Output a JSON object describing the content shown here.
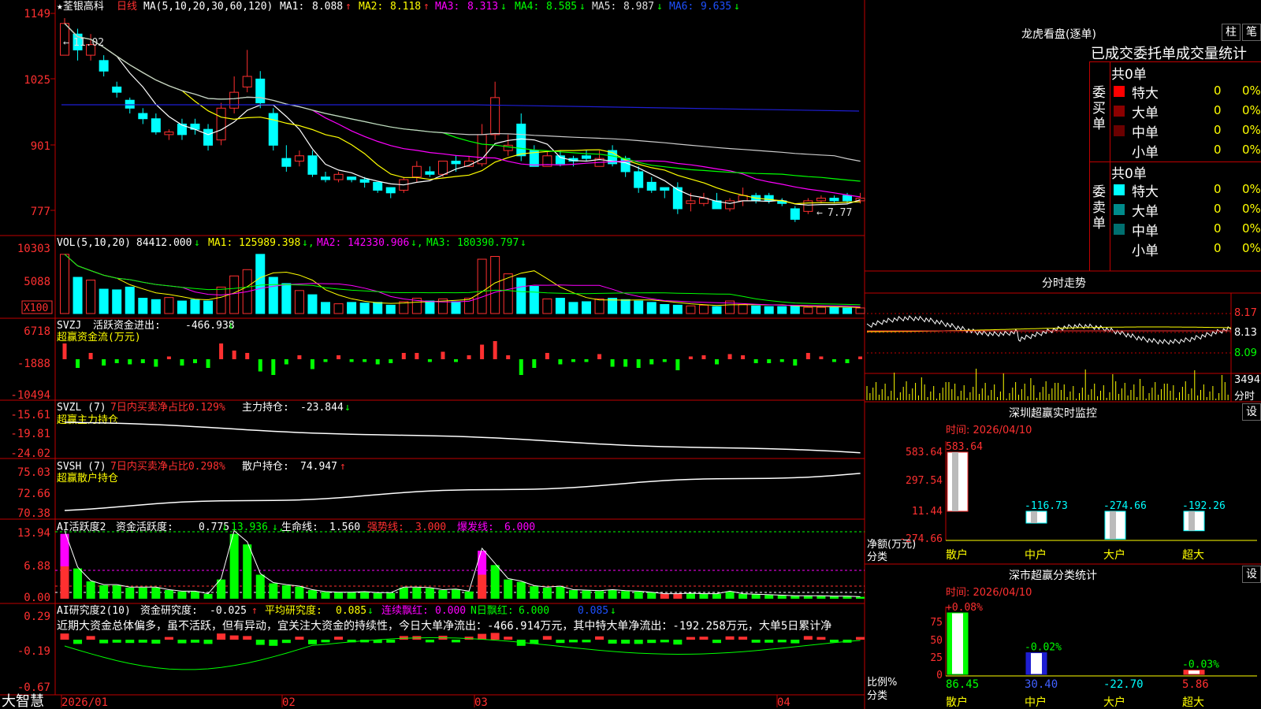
{
  "colors": {
    "up": "#ff3030",
    "down": "#00ffff",
    "bg": "#000000",
    "grid": "#b00000",
    "ma1": "#ffffff",
    "ma2": "#ffff00",
    "ma3": "#ff00ff",
    "ma4": "#00ff00",
    "ma5": "#cccccc",
    "ma6": "#1e1ed2"
  },
  "header": {
    "title": "★荃银高科",
    "period": "日线",
    "ma_params": "MA(5,10,20,30,60,120)",
    "ma": [
      {
        "label": "MA1:",
        "value": "8.088",
        "arrow": "↑"
      },
      {
        "label": "MA2:",
        "value": "8.118",
        "arrow": "↑"
      },
      {
        "label": "MA3:",
        "value": "8.313",
        "arrow": "↓"
      },
      {
        "label": "MA4:",
        "value": "8.585",
        "arrow": "↓"
      },
      {
        "label": "MA5:",
        "value": "8.987",
        "arrow": "↓"
      },
      {
        "label": "MA6:",
        "value": "9.635",
        "arrow": "↓"
      }
    ]
  },
  "price_axis": [
    "1149",
    "1025",
    "901",
    "777"
  ],
  "price_annotations": {
    "high": "11.02",
    "low": "7.77"
  },
  "candles": [
    [
      10.7,
      11.3,
      10.7,
      11.4
    ],
    [
      11.1,
      10.8,
      10.6,
      11.2
    ],
    [
      10.7,
      10.9,
      10.6,
      11.1
    ],
    [
      10.6,
      10.4,
      10.3,
      10.7
    ],
    [
      10.1,
      10.0,
      9.9,
      10.2
    ],
    [
      9.85,
      9.7,
      9.6,
      9.9
    ],
    [
      9.6,
      9.5,
      9.4,
      9.7
    ],
    [
      9.5,
      9.25,
      9.2,
      9.6
    ],
    [
      9.2,
      9.25,
      9.1,
      9.3
    ],
    [
      9.4,
      9.2,
      9.1,
      9.5
    ],
    [
      9.4,
      9.3,
      9.2,
      9.5
    ],
    [
      9.3,
      9.0,
      8.9,
      9.4
    ],
    [
      9.1,
      9.7,
      9.0,
      9.8
    ],
    [
      9.7,
      10.0,
      9.6,
      10.3
    ],
    [
      10.1,
      10.3,
      10.0,
      10.8
    ],
    [
      10.25,
      9.8,
      9.7,
      10.4
    ],
    [
      9.6,
      9.0,
      8.9,
      9.7
    ],
    [
      8.75,
      8.6,
      8.5,
      9.0
    ],
    [
      8.7,
      8.8,
      8.6,
      8.9
    ],
    [
      8.8,
      8.45,
      8.4,
      8.9
    ],
    [
      8.4,
      8.35,
      8.3,
      8.5
    ],
    [
      8.35,
      8.45,
      8.3,
      8.5
    ],
    [
      8.4,
      8.35,
      8.3,
      8.4
    ],
    [
      8.35,
      8.3,
      8.2,
      8.4
    ],
    [
      8.3,
      8.15,
      8.1,
      8.3
    ],
    [
      8.2,
      8.1,
      8.0,
      8.2
    ],
    [
      8.15,
      8.35,
      8.1,
      8.4
    ],
    [
      8.4,
      8.6,
      8.3,
      8.7
    ],
    [
      8.5,
      8.45,
      8.4,
      8.6
    ],
    [
      8.45,
      8.7,
      8.4,
      8.7
    ],
    [
      8.7,
      8.65,
      8.5,
      8.8
    ],
    [
      8.6,
      8.7,
      8.6,
      8.8
    ],
    [
      8.65,
      9.2,
      8.6,
      9.4
    ],
    [
      9.2,
      9.9,
      9.1,
      10.2
    ],
    [
      8.9,
      9.0,
      8.8,
      9.2
    ],
    [
      9.4,
      8.8,
      8.7,
      9.6
    ],
    [
      8.9,
      8.6,
      8.6,
      9.0
    ],
    [
      8.6,
      8.8,
      8.6,
      8.9
    ],
    [
      8.8,
      8.65,
      8.6,
      8.9
    ],
    [
      8.75,
      8.7,
      8.6,
      8.8
    ],
    [
      8.8,
      8.75,
      8.7,
      8.9
    ],
    [
      8.6,
      8.75,
      8.6,
      8.9
    ],
    [
      8.9,
      8.65,
      8.6,
      9.0
    ],
    [
      8.75,
      8.5,
      8.4,
      8.8
    ],
    [
      8.5,
      8.2,
      8.1,
      8.6
    ],
    [
      8.3,
      8.15,
      8.1,
      8.4
    ],
    [
      8.2,
      8.15,
      8.0,
      8.2
    ],
    [
      8.2,
      7.8,
      7.7,
      8.3
    ],
    [
      7.9,
      7.95,
      7.75,
      8.1
    ],
    [
      7.9,
      8.0,
      7.85,
      8.1
    ],
    [
      7.95,
      7.8,
      7.8,
      8.1
    ],
    [
      7.8,
      7.95,
      7.75,
      8.0
    ],
    [
      7.95,
      8.05,
      7.85,
      8.2
    ],
    [
      8.05,
      7.95,
      7.9,
      8.1
    ],
    [
      8.05,
      7.95,
      7.9,
      8.1
    ],
    [
      7.95,
      7.9,
      7.85,
      8.0
    ],
    [
      7.8,
      7.6,
      7.55,
      7.85
    ],
    [
      7.75,
      7.95,
      7.7,
      8.0
    ],
    [
      7.95,
      8.0,
      7.9,
      8.05
    ],
    [
      8.0,
      7.95,
      7.9,
      8.05
    ],
    [
      8.05,
      7.95,
      7.9,
      8.1
    ],
    [
      7.95,
      8.0,
      7.9,
      8.1
    ]
  ],
  "vol_header": {
    "name": "VOL(5,10,20)",
    "value": "84412.000",
    "arrow": "↓",
    "ma1": "125989.398",
    "ma2": "142330.906",
    "ma3": "180390.797",
    "ma1_label": "MA1:",
    "ma2_label": "MA2:",
    "ma3_label": "MA3:"
  },
  "vol_axis": [
    "10303",
    "5088",
    "X100"
  ],
  "volumes": [
    8.5,
    5.2,
    4.8,
    3.5,
    3.4,
    3.8,
    2.2,
    2.0,
    2.3,
    1.8,
    2.0,
    1.8,
    3.8,
    5.4,
    6.3,
    8.5,
    5.2,
    4.3,
    3.3,
    2.7,
    1.6,
    1.4,
    1.6,
    1.5,
    1.6,
    1.2,
    1.7,
    2.2,
    1.8,
    2.1,
    1.7,
    2.2,
    7.8,
    8.2,
    5.7,
    5.1,
    3.9,
    2.1,
    2.2,
    1.6,
    1.7,
    2.1,
    2.2,
    2.0,
    1.8,
    1.6,
    1.3,
    1.2,
    1.1,
    1.2,
    1.0,
    1.8,
    1.3,
    1.1,
    1.0,
    1.0,
    1.1,
    0.9,
    0.9,
    0.9,
    0.8,
    0.8
  ],
  "svzj": {
    "name": "SVZJ",
    "desc": "活跃资金进出:",
    "value": "-466.938",
    "arrow": "↓",
    "sub": "超赢资金流(万元)",
    "axis": [
      "6718",
      "-1888",
      "-10494"
    ]
  },
  "svzl": {
    "name": "SVZL (7)",
    "desc": "7日内买卖净占比0.129%",
    "hold_label": "主力持仓:",
    "hold_value": "-23.844",
    "arrow": "↓",
    "sub": "超赢主力持仓",
    "axis": [
      "-15.61",
      "-19.81",
      "-24.02"
    ]
  },
  "svsh": {
    "name": "SVSH (7)",
    "desc": "7日内买卖净占比0.298%",
    "hold_label": "散户持仓:",
    "hold_value": "74.947",
    "arrow": "↑",
    "sub": "超赢散户持仓",
    "axis": [
      "75.03",
      "72.66",
      "70.38"
    ]
  },
  "ai1": {
    "name": "AI活跃度2",
    "l1": "资金活跃度:",
    "v1": "0.775",
    "a1": "↓",
    "v2": "13.936",
    "l3": "生命线:",
    "v3": "1.560",
    "l4": "强势线:",
    "v4": "3.000",
    "l5": "爆发线:",
    "v5": "6.000",
    "axis": [
      "13.94",
      "6.88",
      "0.00"
    ]
  },
  "ai2": {
    "name": "AI研究度2(10)",
    "l1": "资金研究度:",
    "v1": "-0.025",
    "a1": "↑",
    "l2": "平均研究度:",
    "v2": "0.085",
    "a2": "↓",
    "l3": "连续飘红:",
    "v3": "0.000",
    "l4": "N日飘红:",
    "v4": "6.000",
    "v5": "0.085",
    "a5": "↓",
    "comment": "近期大资金总体偏多，虽不活跃，但有异动，宜关注大资金的持续性，今日大单净流出：-466.914万元，其中特大单净流出：-192.258万元，大单5日累计净",
    "axis": [
      "0.29",
      "-0.19",
      "-0.67"
    ]
  },
  "date_axis": [
    "2026/01",
    "02",
    "03",
    "04"
  ],
  "footer": {
    "brand": "大智慧"
  },
  "lhb": {
    "title": "龙虎看盘(逐单)",
    "btn1": "柱",
    "btn2": "笔",
    "subtitle": "已成交委托单成交量统计",
    "buy": {
      "label": "委买单",
      "total": "共0单",
      "rows": [
        {
          "name": "特大",
          "count": "0",
          "pct": "0%",
          "color": "#ff0000"
        },
        {
          "name": "大单",
          "count": "0",
          "pct": "0%",
          "color": "#8b0000"
        },
        {
          "name": "中单",
          "count": "0",
          "pct": "0%",
          "color": "#6a0000"
        },
        {
          "name": "小单",
          "count": "0",
          "pct": "0%",
          "color": "#000000"
        }
      ]
    },
    "sell": {
      "label": "委卖单",
      "total": "共0单",
      "rows": [
        {
          "name": "特大",
          "count": "0",
          "pct": "0%",
          "color": "#00ffff"
        },
        {
          "name": "大单",
          "count": "0",
          "pct": "0%",
          "color": "#008b8b"
        },
        {
          "name": "中单",
          "count": "0",
          "pct": "0%",
          "color": "#006f6f"
        },
        {
          "name": "小单",
          "count": "0",
          "pct": "0%",
          "color": "#000000"
        }
      ]
    }
  },
  "fenshi": {
    "title": "分时走势",
    "axis": [
      "8.17",
      "8.13",
      "8.09"
    ],
    "vol_value": "3494",
    "vol_label": "分时"
  },
  "monitor": {
    "title": "深圳超赢实时监控",
    "btn": "设",
    "time": "时间: 2026/04/10",
    "axis": [
      "583.64",
      "297.54",
      "11.44",
      "-274.66"
    ],
    "ylabel": "净额(万元)",
    "xlabel": "分类",
    "bars": [
      {
        "cat": "散户",
        "value": "583.64"
      },
      {
        "cat": "中户",
        "value": "-116.73"
      },
      {
        "cat": "大户",
        "value": "-274.66"
      },
      {
        "cat": "超大",
        "value": "-192.26"
      }
    ]
  },
  "classify": {
    "title": "深市超赢分类统计",
    "btn": "设",
    "time": "时间: 2026/04/10",
    "axis": [
      "75",
      "50",
      "25",
      "0"
    ],
    "ylabel": "比例%",
    "xlabel": "分类",
    "bars": [
      {
        "cat": "散户",
        "pct": "86.45",
        "delta": "+0.08%"
      },
      {
        "cat": "中户",
        "pct": "30.40",
        "delta": "-0.02%"
      },
      {
        "cat": "大户",
        "pct": "-22.70",
        "delta": ""
      },
      {
        "cat": "超大",
        "pct": "5.86",
        "delta": "-0.03%"
      }
    ]
  }
}
